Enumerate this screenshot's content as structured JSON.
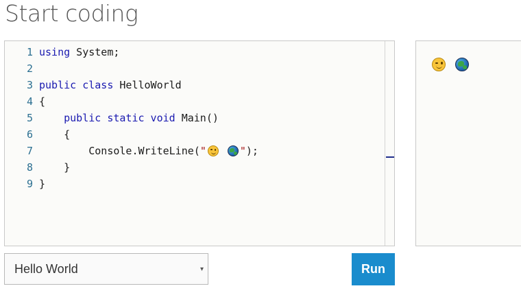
{
  "page": {
    "title": "Start coding"
  },
  "editor": {
    "lines": [
      {
        "n": "1",
        "parts": [
          {
            "t": "using",
            "k": "kw"
          },
          {
            "t": " System;",
            "k": "src"
          }
        ]
      },
      {
        "n": "2",
        "parts": []
      },
      {
        "n": "3",
        "parts": [
          {
            "t": "public class",
            "k": "kw"
          },
          {
            "t": " HelloWorld",
            "k": "src"
          }
        ]
      },
      {
        "n": "4",
        "parts": [
          {
            "t": "{",
            "k": "src"
          }
        ]
      },
      {
        "n": "5",
        "parts": [
          {
            "t": "    public static void",
            "k": "kw"
          },
          {
            "t": " Main()",
            "k": "src"
          }
        ]
      },
      {
        "n": "6",
        "parts": [
          {
            "t": "    {",
            "k": "src"
          }
        ]
      },
      {
        "n": "7",
        "parts": [
          {
            "t": "        Console.WriteLine(",
            "k": "src"
          },
          {
            "t": "\"",
            "k": "str"
          },
          {
            "t": "wink-face-emoji",
            "k": "face"
          },
          {
            "t": " ",
            "k": "src"
          },
          {
            "t": "globe-emoji",
            "k": "globe"
          },
          {
            "t": "\"",
            "k": "str"
          },
          {
            "t": ");",
            "k": "src"
          }
        ]
      },
      {
        "n": "8",
        "parts": [
          {
            "t": "    }",
            "k": "src"
          }
        ]
      },
      {
        "n": "9",
        "parts": [
          {
            "t": "}",
            "k": "src"
          }
        ]
      }
    ]
  },
  "output": {
    "icons": [
      "wink-face-emoji",
      "globe-emoji"
    ]
  },
  "controls": {
    "sample_selected": "Hello World",
    "run_label": "Run"
  },
  "colors": {
    "keyword": "#1a1ab0",
    "string": "#a31515",
    "line_number": "#2b6f91",
    "run_button": "#1a8ccd"
  }
}
